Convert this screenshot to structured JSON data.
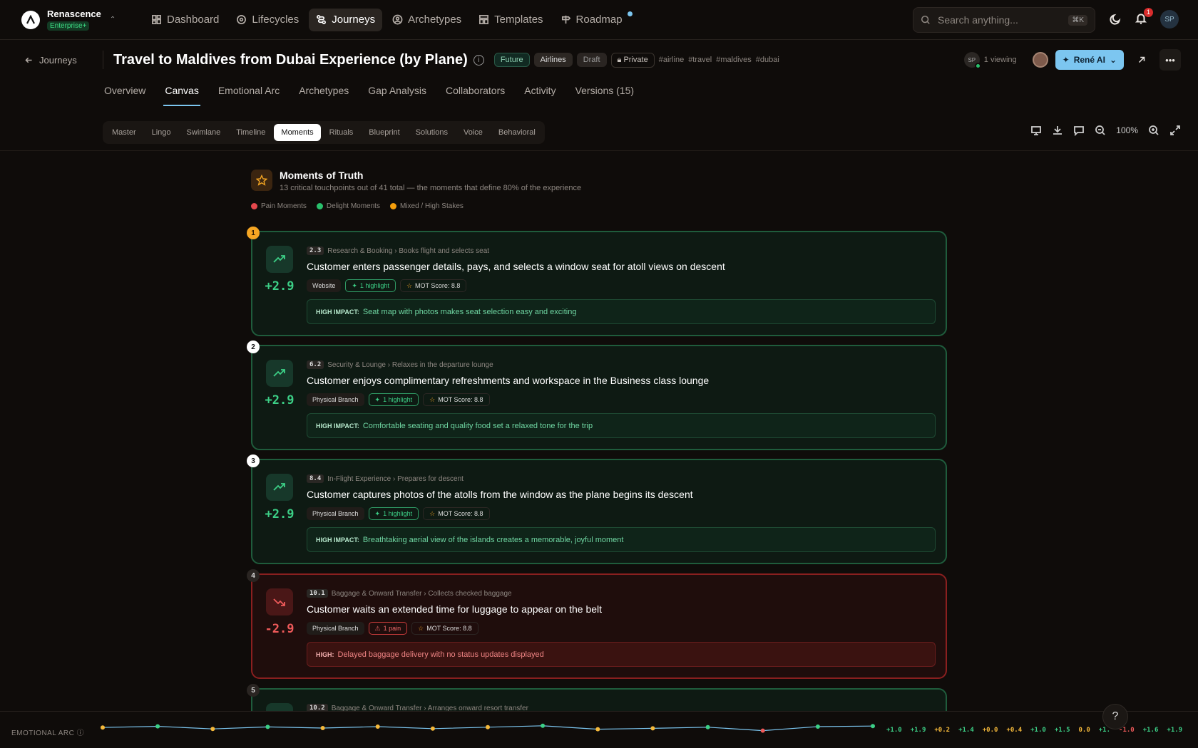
{
  "brand": {
    "name": "Renascence",
    "tier": "Enterprise+"
  },
  "nav": [
    {
      "label": "Dashboard",
      "icon": "dashboard-icon"
    },
    {
      "label": "Lifecycles",
      "icon": "lifecycle-icon"
    },
    {
      "label": "Journeys",
      "icon": "journeys-icon",
      "active": true
    },
    {
      "label": "Archetypes",
      "icon": "archetype-icon"
    },
    {
      "label": "Templates",
      "icon": "templates-icon"
    },
    {
      "label": "Roadmap",
      "icon": "roadmap-icon"
    }
  ],
  "search": {
    "placeholder": "Search anything...",
    "shortcut": "⌘K"
  },
  "notifications": {
    "count": "1"
  },
  "user": {
    "initials": "SP"
  },
  "header": {
    "back_label": "Journeys",
    "title": "Travel to Maldives from Dubai Experience (by Plane)",
    "chips": [
      "Future",
      "Airlines",
      "Draft",
      "Private"
    ],
    "tags": [
      "#airline",
      "#travel",
      "#maldives",
      "#dubai"
    ],
    "viewing_initials": "SP",
    "viewing_text": "1 viewing",
    "ai_button": "René AI"
  },
  "tabs": [
    "Overview",
    "Canvas",
    "Emotional Arc",
    "Archetypes",
    "Gap Analysis",
    "Collaborators",
    "Activity",
    "Versions (15)"
  ],
  "active_tab": "Canvas",
  "views": [
    "Master",
    "Lingo",
    "Swimlane",
    "Timeline",
    "Moments",
    "Rituals",
    "Blueprint",
    "Solutions",
    "Voice",
    "Behavioral"
  ],
  "active_view": "Moments",
  "zoom": "100%",
  "moments": {
    "title": "Moments of Truth",
    "subtitle": "13 critical touchpoints out of 41 total — the moments that define 80% of the experience",
    "legend": [
      {
        "label": "Pain Moments",
        "color": "#e5484d"
      },
      {
        "label": "Delight Moments",
        "color": "#29c06c"
      },
      {
        "label": "Mixed / High Stakes",
        "color": "#f59e0b"
      }
    ],
    "cards": [
      {
        "num": "1",
        "type": "delight",
        "delta": "+2.9",
        "code": "2.3",
        "crumb": "Research & Booking › Books flight and selects seat",
        "title": "Customer enters passenger details, pays, and selects a window seat for atoll views on descent",
        "channel": "Website",
        "signal": "1 highlight",
        "score": "MOT Score: 8.8",
        "impact_label": "HIGH IMPACT:",
        "impact": "Seat map with photos makes seat selection easy and exciting"
      },
      {
        "num": "2",
        "type": "delight",
        "delta": "+2.9",
        "code": "6.2",
        "crumb": "Security & Lounge › Relaxes in the departure lounge",
        "title": "Customer enjoys complimentary refreshments and workspace in the Business class lounge",
        "channel": "Physical Branch",
        "signal": "1 highlight",
        "score": "MOT Score: 8.8",
        "impact_label": "HIGH IMPACT:",
        "impact": "Comfortable seating and quality food set a relaxed tone for the trip"
      },
      {
        "num": "3",
        "type": "delight",
        "delta": "+2.9",
        "code": "8.4",
        "crumb": "In-Flight Experience › Prepares for descent",
        "title": "Customer captures photos of the atolls from the window as the plane begins its descent",
        "channel": "Physical Branch",
        "signal": "1 highlight",
        "score": "MOT Score: 8.8",
        "impact_label": "HIGH IMPACT:",
        "impact": "Breathtaking aerial view of the islands creates a memorable, joyful moment"
      },
      {
        "num": "4",
        "type": "pain",
        "delta": "-2.9",
        "code": "10.1",
        "crumb": "Baggage & Onward Transfer › Collects checked baggage",
        "title": "Customer waits an extended time for luggage to appear on the belt",
        "channel": "Physical Branch",
        "signal": "1 pain",
        "score": "MOT Score: 8.8",
        "impact_label": "HIGH:",
        "impact": "Delayed baggage delivery with no status updates displayed"
      },
      {
        "num": "5",
        "type": "delight",
        "delta": "",
        "code": "10.2",
        "crumb": "Baggage & Onward Transfer › Arranges onward resort transfer",
        "title": "",
        "channel": "",
        "signal": "",
        "score": "",
        "impact_label": "",
        "impact": ""
      }
    ]
  },
  "emotional_arc": {
    "label": "EMOTIONAL ARC",
    "values": [
      "+1.0",
      "+1.9",
      "+0.2",
      "+1.4",
      "+0.0",
      "+0.4",
      "+1.0",
      "+1.5",
      "0.0",
      "+1.",
      "-1.0",
      "+1.6",
      "+1.9"
    ],
    "colors": {
      "positive": "#3ccf86",
      "neutral": "#f5b93b",
      "negative": "#ef5a5a"
    }
  }
}
